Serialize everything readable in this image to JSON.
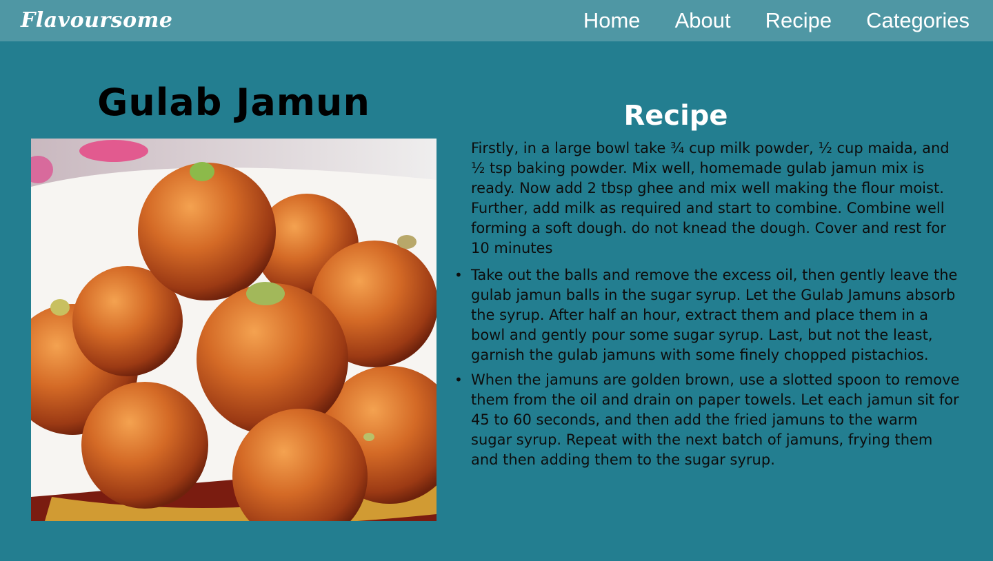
{
  "nav": {
    "brand": "Flavoursome",
    "links": [
      "Home",
      "About",
      "Recipe",
      "Categories"
    ]
  },
  "dish": {
    "title": "Gulab Jamun"
  },
  "recipe": {
    "heading": "Recipe",
    "intro": "Firstly, in a large bowl take ¾ cup milk powder, ½ cup maida, and ½ tsp baking powder. Mix well, homemade gulab jamun mix is ready. Now add 2 tbsp ghee and mix well making the flour moist. Further, add milk as required and start to combine. Combine well forming a soft dough. do not knead the dough. Cover and rest for 10 minutes",
    "steps": [
      "Take out the balls and remove the excess oil, then gently leave the gulab jamun balls in the sugar syrup. Let the Gulab Jamuns absorb the syrup. After half an hour, extract them and place them in a bowl and gently pour some sugar syrup. Last, but not the least, garnish the gulab jamuns with some finely chopped pistachios.",
      "When the jamuns are golden brown, use a slotted spoon to remove them from the oil and drain on paper towels. Let each jamun sit for 45 to 60 seconds, and then add the fried jamuns to the warm sugar syrup. Repeat with the next batch of jamuns, frying them and then adding them to the sugar syrup."
    ]
  },
  "colors": {
    "page_bg": "#237e90",
    "navbar_bg": "#4f97a4",
    "heading_white": "#ffffff",
    "body_text": "#0d0d0d"
  }
}
